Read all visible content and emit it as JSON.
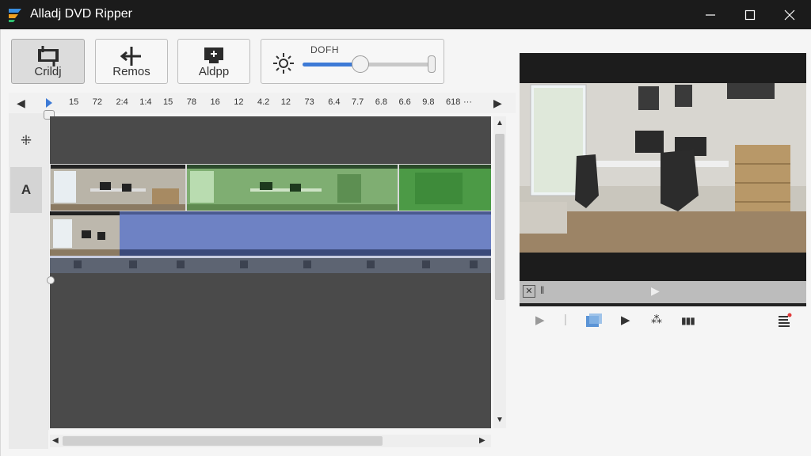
{
  "window": {
    "title": "Alladj DVD Ripper"
  },
  "toolbar": {
    "crop_label": "Crildj",
    "remove_label": "Remos",
    "add_label": "Aldpp",
    "brightness_label": "DOFH",
    "brightness_level": 0.44
  },
  "timeline": {
    "ruler_ticks": [
      "15",
      "72",
      "2:4",
      "1:4",
      "15",
      "78",
      "16",
      "12",
      "4.2",
      "12",
      "73",
      "6.4",
      "7.7",
      "6.8",
      "6.6",
      "9.8",
      "618"
    ],
    "ruler_more": "···"
  },
  "colors": {
    "accent": "#3d7ad6",
    "clip_green": "#5aa45a",
    "clip_blue": "#6e82c4",
    "track_bg": "#4a4a4a"
  }
}
